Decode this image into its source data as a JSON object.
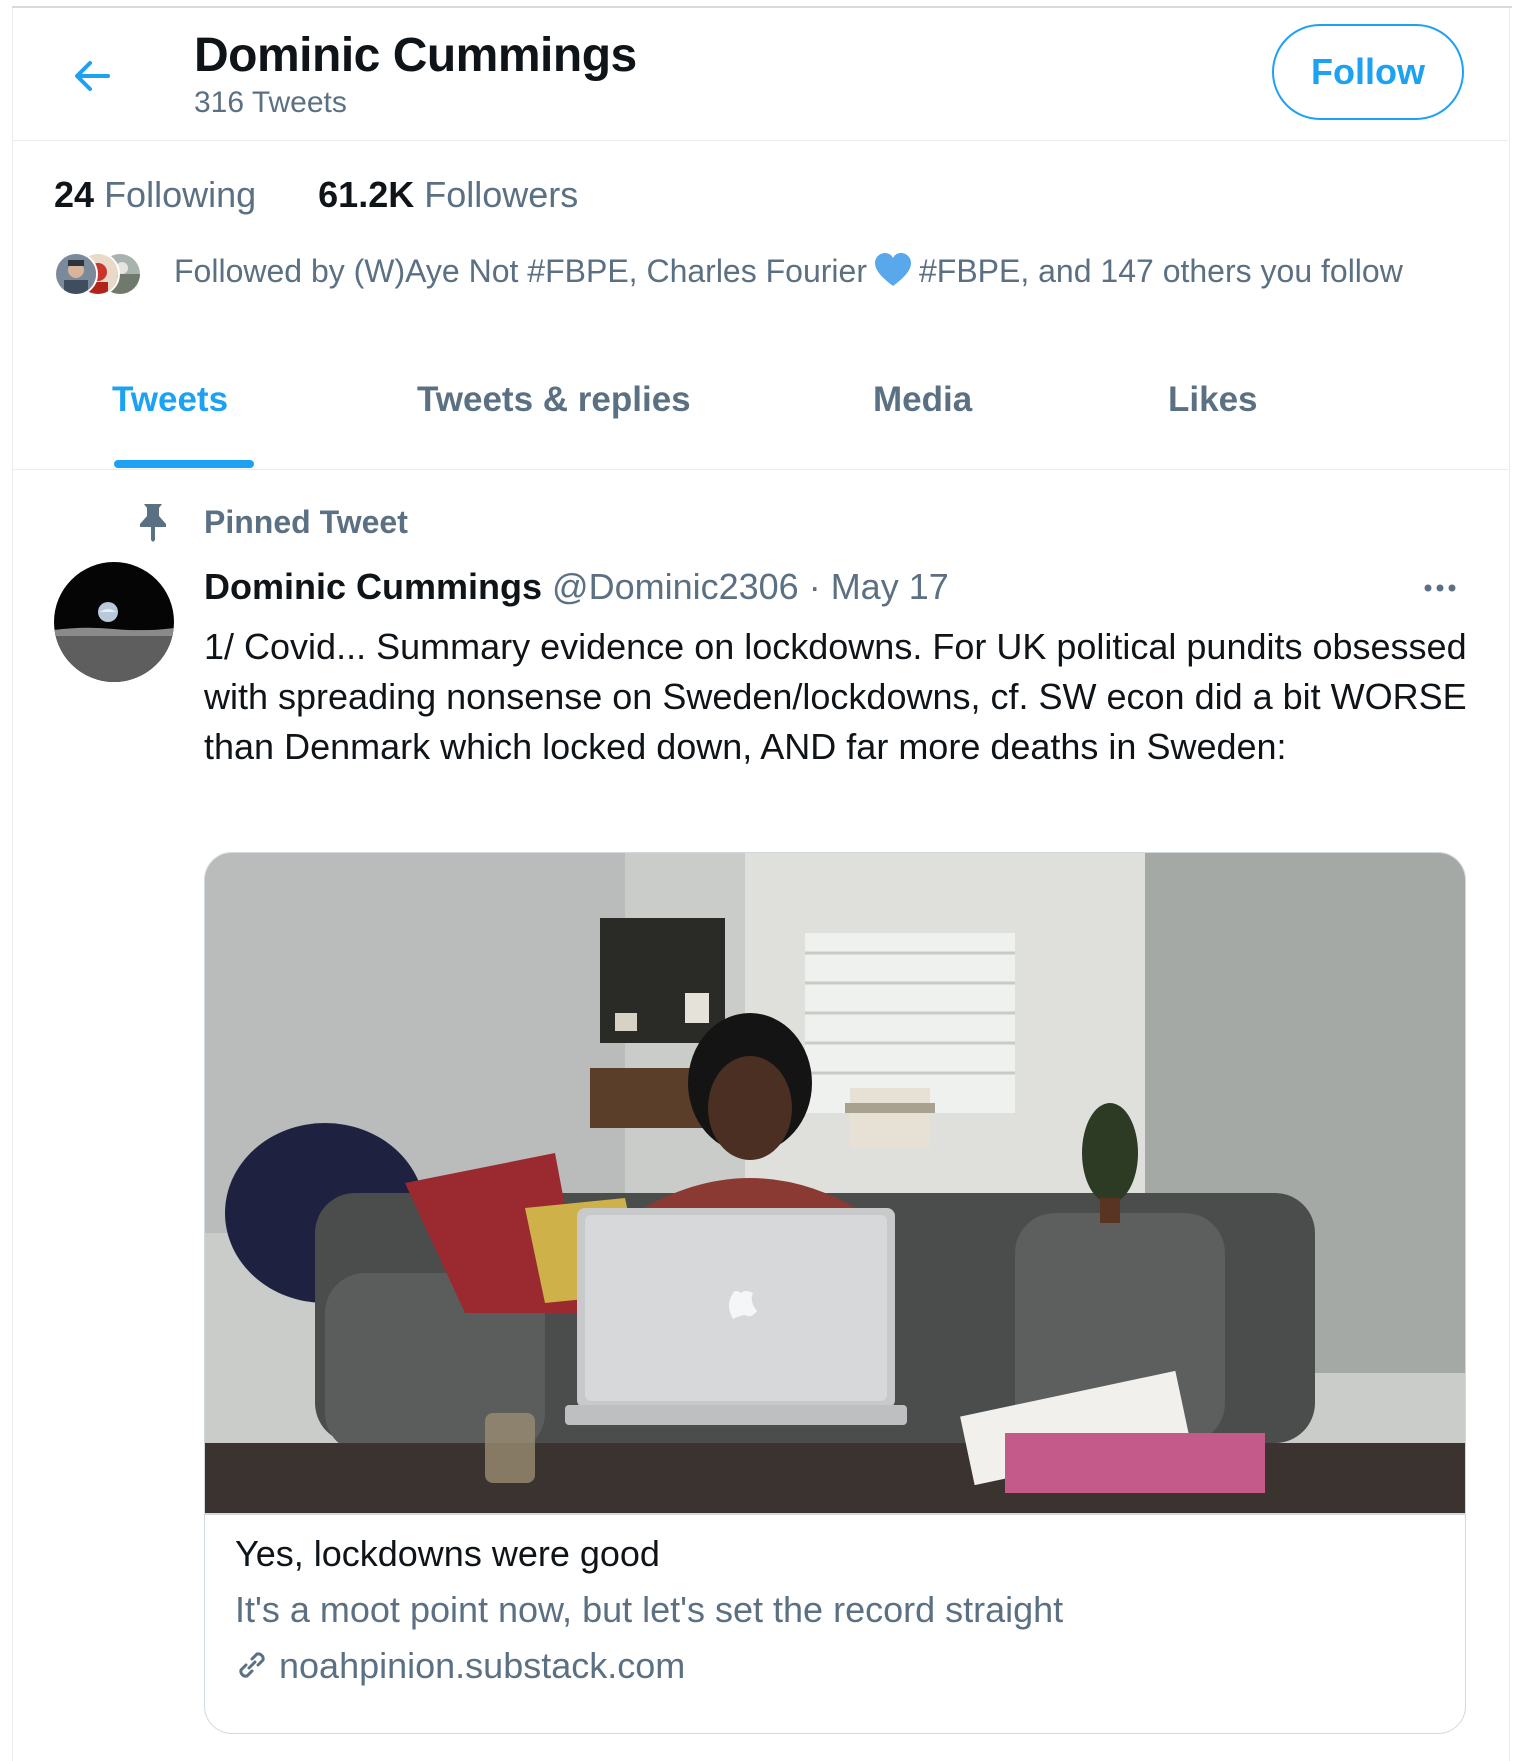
{
  "header": {
    "name": "Dominic Cummings",
    "tweet_count": "316 Tweets",
    "follow_label": "Follow"
  },
  "stats": {
    "following_count": "24",
    "following_label": "Following",
    "followers_count": "61.2K",
    "followers_label": "Followers"
  },
  "followed_by": {
    "text_before_heart": "Followed by (W)Aye Not #FBPE, Charles Fourier",
    "text_after_heart": "#FBPE, and 147 others you follow"
  },
  "tabs": [
    {
      "label": "Tweets",
      "active": true
    },
    {
      "label": "Tweets & replies",
      "active": false
    },
    {
      "label": "Media",
      "active": false
    },
    {
      "label": "Likes",
      "active": false
    }
  ],
  "pinned": {
    "label": "Pinned Tweet"
  },
  "tweet": {
    "author": "Dominic Cummings",
    "handle_date": "@Dominic2306 · May 17",
    "text": "1/ Covid... Summary evidence on lockdowns. For UK political pundits obsessed with spreading nonsense on Sweden/lockdowns, cf. SW econ did a bit WORSE than Denmark which locked down, AND far more deaths in Sweden:"
  },
  "card": {
    "title": "Yes, lockdowns were good",
    "description": "It's a moot point now, but let's set the record straight",
    "domain": "noahpinion.substack.com"
  },
  "colors": {
    "accent": "#1da1f2",
    "secondary_text": "#5b7083",
    "primary_text": "#0f1419",
    "heart": "#1da1f2"
  },
  "icons": [
    "arrow-left-icon",
    "heart-icon",
    "pin-icon",
    "more-horizontal-icon",
    "link-icon"
  ]
}
